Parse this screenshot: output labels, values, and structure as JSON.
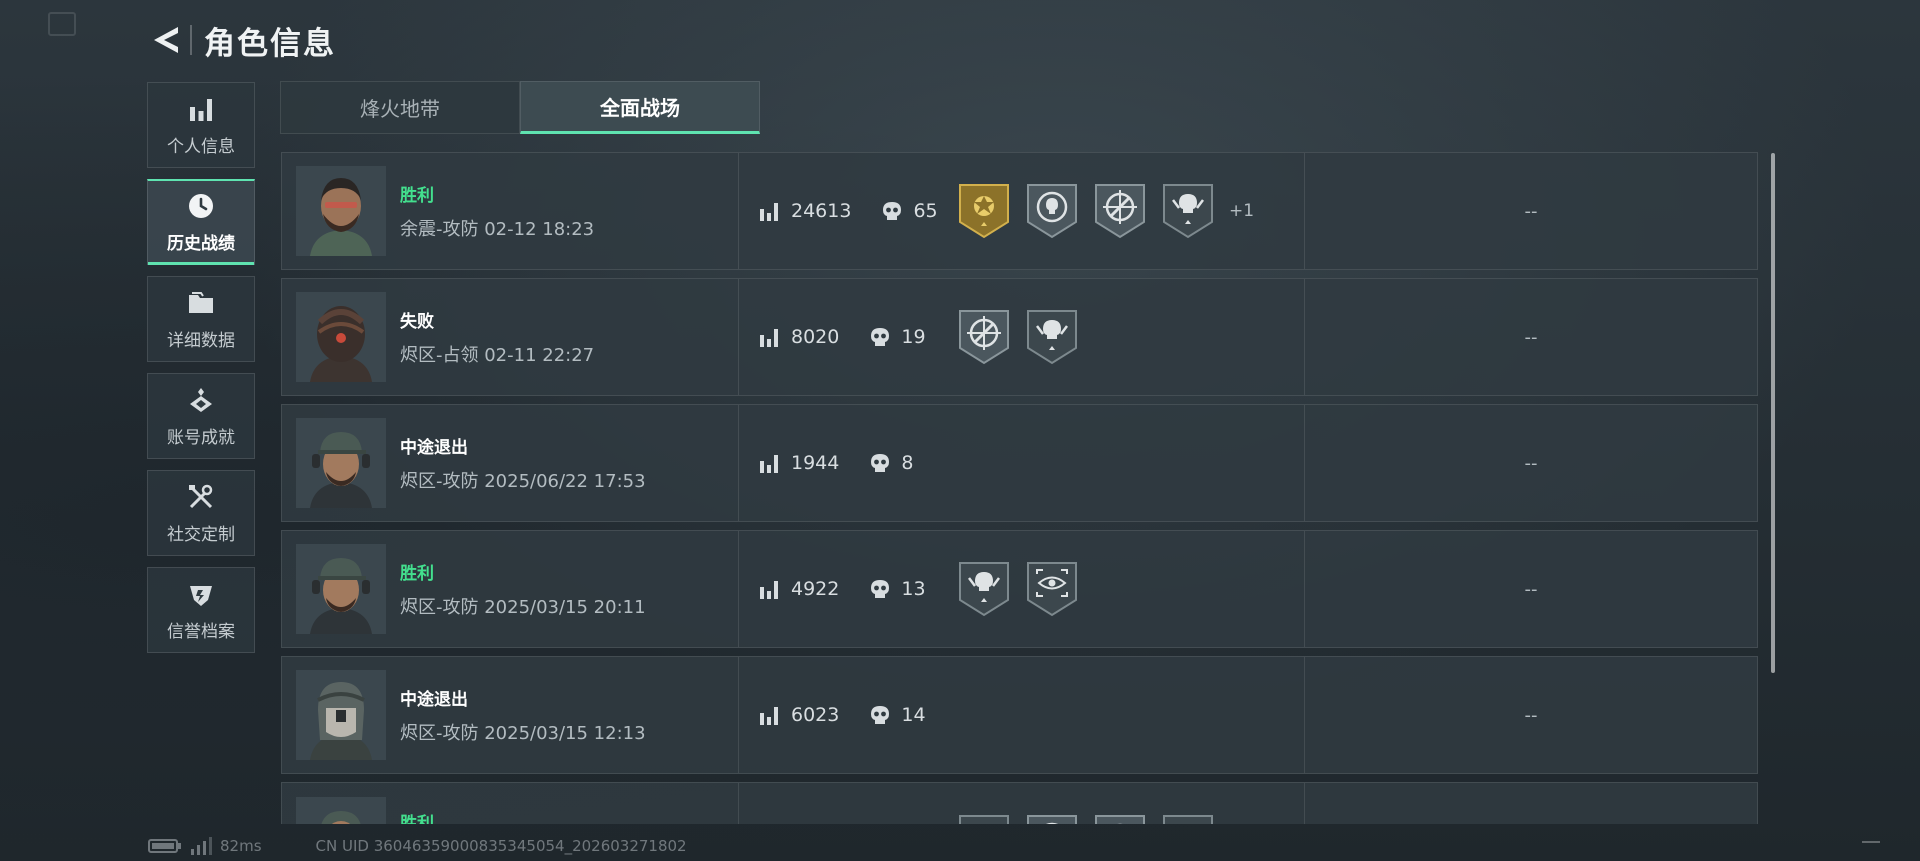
{
  "header": {
    "title": "角色信息"
  },
  "sidebar": {
    "items": [
      {
        "label": "个人信息",
        "icon": "stats-bars-icon",
        "active": false
      },
      {
        "label": "历史战绩",
        "icon": "clock-icon",
        "active": true
      },
      {
        "label": "详细数据",
        "icon": "folder-icon",
        "active": false
      },
      {
        "label": "账号成就",
        "icon": "achievement-icon",
        "active": false
      },
      {
        "label": "社交定制",
        "icon": "tools-icon",
        "active": false
      },
      {
        "label": "信誉档案",
        "icon": "credit-icon",
        "active": false
      }
    ]
  },
  "tabs": [
    {
      "label": "烽火地带",
      "active": false
    },
    {
      "label": "全面战场",
      "active": true
    }
  ],
  "matches": [
    {
      "result": "胜利",
      "result_type": "win",
      "meta": "余震-攻防 02-12 18:23",
      "score": "24613",
      "kills": "65",
      "badges": [
        "gold-medal-icon",
        "skull-target-icon",
        "crosshair-icon",
        "skull-wings-icon"
      ],
      "extra_badges": "+1",
      "last": "--"
    },
    {
      "result": "失败",
      "result_type": "lose",
      "meta": "烬区-占领 02-11 22:27",
      "score": "8020",
      "kills": "19",
      "badges": [
        "crosshair-icon",
        "skull-wings-icon"
      ],
      "extra_badges": "",
      "last": "--"
    },
    {
      "result": "中途退出",
      "result_type": "quit",
      "meta": "烬区-攻防 2025/06/22 17:53",
      "score": "1944",
      "kills": "8",
      "badges": [],
      "extra_badges": "",
      "last": "--"
    },
    {
      "result": "胜利",
      "result_type": "win",
      "meta": "烬区-攻防 2025/03/15 20:11",
      "score": "4922",
      "kills": "13",
      "badges": [
        "skull-wings-icon",
        "eye-scope-icon"
      ],
      "extra_badges": "",
      "last": "--"
    },
    {
      "result": "中途退出",
      "result_type": "quit",
      "meta": "烬区-攻防 2025/03/15 12:13",
      "score": "6023",
      "kills": "14",
      "badges": [],
      "extra_badges": "",
      "last": "--"
    },
    {
      "result": "胜利",
      "result_type": "win",
      "meta": "",
      "score": "",
      "kills": "",
      "badges": [
        "eye-scope-icon",
        "skull-target-icon",
        "crosshair-icon",
        "skull-wings-icon"
      ],
      "extra_badges": "",
      "last": ""
    }
  ],
  "footer": {
    "ping": "82ms",
    "uid": "CN UID 3604635900083534505​4_202603271802"
  },
  "colors": {
    "accent": "#5fe3b0",
    "win": "#43e08e",
    "gold": "#b8942e"
  }
}
